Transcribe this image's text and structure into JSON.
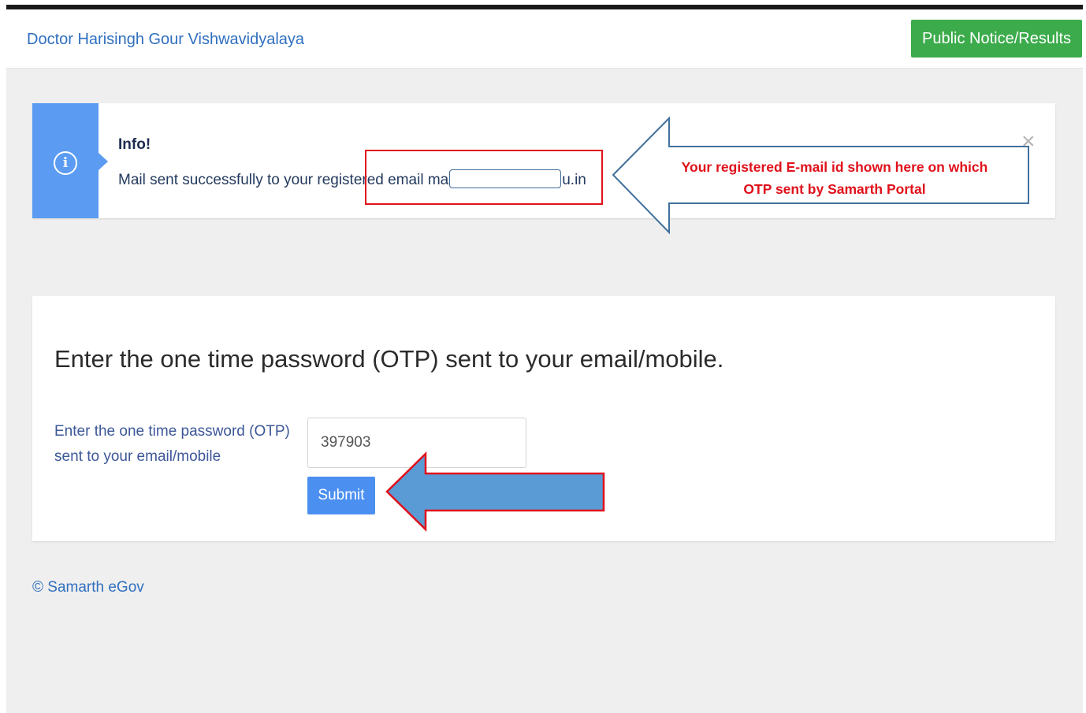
{
  "navbar": {
    "brand": "Doctor Harisingh Gour Vishwavidyalaya",
    "notice_button": "Public Notice/Results"
  },
  "alert": {
    "icon": "info-icon",
    "title": "Info!",
    "message_before": "Mail sent successfully to your registered email ma",
    "message_after": "u.in",
    "close_glyph": "×"
  },
  "annotation": {
    "callout_line1": "Your registered E-mail id shown here on which",
    "callout_line2": "OTP sent by Samarth Portal"
  },
  "otp": {
    "heading": "Enter the one time password (OTP) sent to your email/mobile.",
    "label": "Enter the one time password (OTP) sent to your email/mobile",
    "value": "397903",
    "submit_label": "Submit"
  },
  "footer": {
    "copyright": "© Samarth eGov"
  },
  "colors": {
    "brand_blue": "#2f6fbf",
    "notice_green": "#3cab4b",
    "info_blue": "#5b9cf2",
    "annotation_red": "#e0111b",
    "arrow_fill": "#5b9bd5"
  }
}
